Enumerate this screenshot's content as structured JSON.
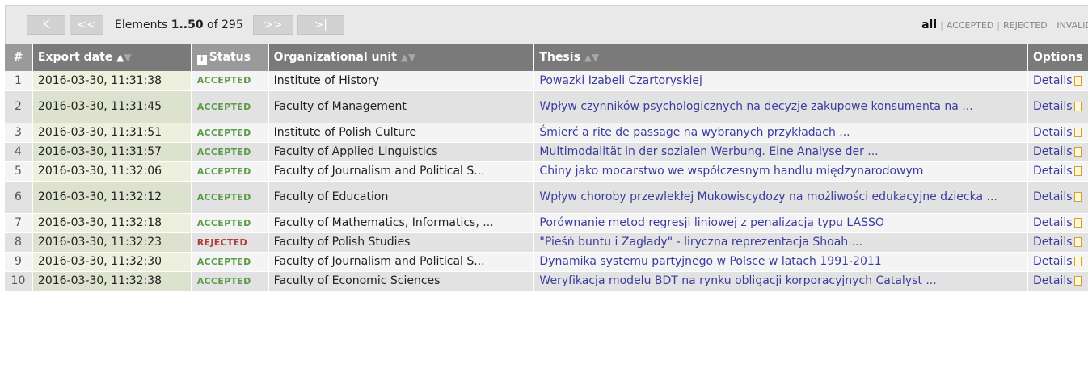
{
  "pagination": {
    "first_label": "K",
    "prev_label": "<<",
    "next_label": ">>",
    "last_label": ">|",
    "elements_prefix": "Elements",
    "range": "1..50",
    "of_label": "of",
    "total": "295"
  },
  "filters": [
    "all",
    "ACCEPTED",
    "REJECTED",
    "INVALID"
  ],
  "columns": {
    "num": "#",
    "export_date": "Export date",
    "status": "Status",
    "org_unit": "Organizational unit",
    "thesis": "Thesis",
    "options": "Options"
  },
  "rows": [
    {
      "num": "1",
      "date": "2016-03-30, 11:31:38",
      "status": "ACCEPTED",
      "unit": "Institute of History",
      "thesis": "Powązki Izabeli Czartoryskiej",
      "details": "Details"
    },
    {
      "num": "2",
      "date": "2016-03-30, 11:31:45",
      "status": "ACCEPTED",
      "unit": "Faculty of Management",
      "thesis": "Wpływ czynników psychologicznych na decyzje zakupowe konsumenta na ...",
      "details": "Details"
    },
    {
      "num": "3",
      "date": "2016-03-30, 11:31:51",
      "status": "ACCEPTED",
      "unit": "Institute of Polish Culture",
      "thesis": "Śmierć a rite de passage na wybranych przykładach ...",
      "details": "Details"
    },
    {
      "num": "4",
      "date": "2016-03-30, 11:31:57",
      "status": "ACCEPTED",
      "unit": "Faculty of Applied Linguistics",
      "thesis": "Multimodalität in der sozialen Werbung. Eine Analyse der ...",
      "details": "Details"
    },
    {
      "num": "5",
      "date": "2016-03-30, 11:32:06",
      "status": "ACCEPTED",
      "unit": "Faculty of Journalism and Political S...",
      "thesis": "Chiny jako mocarstwo we współczesnym handlu międzynarodowym",
      "details": "Details"
    },
    {
      "num": "6",
      "date": "2016-03-30, 11:32:12",
      "status": "ACCEPTED",
      "unit": "Faculty of Education",
      "thesis": "Wpływ choroby przewlekłej Mukowiscydozy na możliwości edukacyjne dziecka ...",
      "details": "Details"
    },
    {
      "num": "7",
      "date": "2016-03-30, 11:32:18",
      "status": "ACCEPTED",
      "unit": "Faculty of Mathematics, Informatics, ...",
      "thesis": "Porównanie metod regresji liniowej z penalizacją typu LASSO",
      "details": "Details"
    },
    {
      "num": "8",
      "date": "2016-03-30, 11:32:23",
      "status": "REJECTED",
      "unit": "Faculty of Polish Studies",
      "thesis": "\"Pieśń buntu i Zagłady\" - liryczna reprezentacja Shoah ...",
      "details": "Details"
    },
    {
      "num": "9",
      "date": "2016-03-30, 11:32:30",
      "status": "ACCEPTED",
      "unit": "Faculty of Journalism and Political S...",
      "thesis": "Dynamika systemu partyjnego w Polsce w latach 1991-2011",
      "details": "Details"
    },
    {
      "num": "10",
      "date": "2016-03-30, 11:32:38",
      "status": "ACCEPTED",
      "unit": "Faculty of Economic Sciences",
      "thesis": "Weryfikacja modelu BDT na rynku obligacji korporacyjnych Catalyst ...",
      "details": "Details"
    }
  ],
  "colors": {
    "accepted": "#5d9b48",
    "rejected": "#b23b3b",
    "link": "#3c3c9e",
    "header_bg": "#7a7a7a"
  }
}
